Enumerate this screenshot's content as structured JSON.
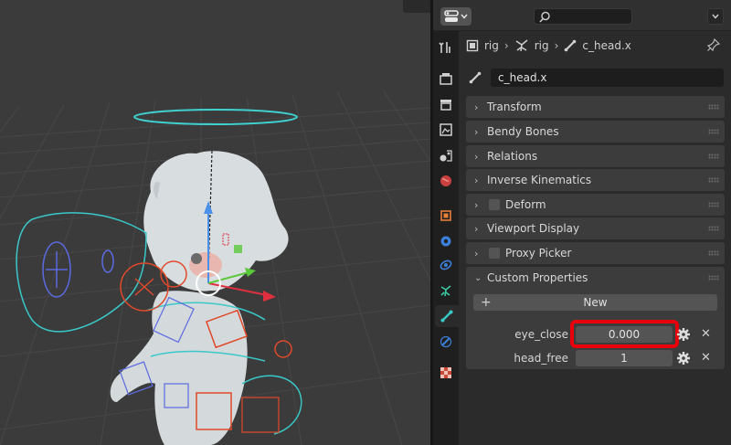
{
  "properties_editor": {
    "breadcrumb": [
      "rig",
      "rig",
      "c_head.x"
    ],
    "bone_name": "c_head.x",
    "panels": [
      {
        "label": "Transform",
        "checkbox": false
      },
      {
        "label": "Bendy Bones",
        "checkbox": false
      },
      {
        "label": "Relations",
        "checkbox": false
      },
      {
        "label": "Inverse Kinematics",
        "checkbox": false
      },
      {
        "label": "Deform",
        "checkbox": true
      },
      {
        "label": "Viewport Display",
        "checkbox": false
      },
      {
        "label": "Proxy Picker",
        "checkbox": true
      }
    ],
    "custom_properties": {
      "label": "Custom Properties",
      "new_label": "New",
      "props": [
        {
          "name": "eye_close",
          "value": "0.000"
        },
        {
          "name": "head_free",
          "value": "1"
        }
      ]
    },
    "tabs": [
      "tool-icon",
      "render-icon",
      "output-icon",
      "view-layer-icon",
      "scene-icon",
      "world-icon",
      "object-icon",
      "modifier-icon",
      "particles-icon",
      "physics-icon",
      "object-data-armature-icon",
      "bone-icon",
      "bone-constraint-icon",
      "texture-icon"
    ],
    "highlight_color": "#e8000c",
    "accent_color": "#4a90d9"
  }
}
